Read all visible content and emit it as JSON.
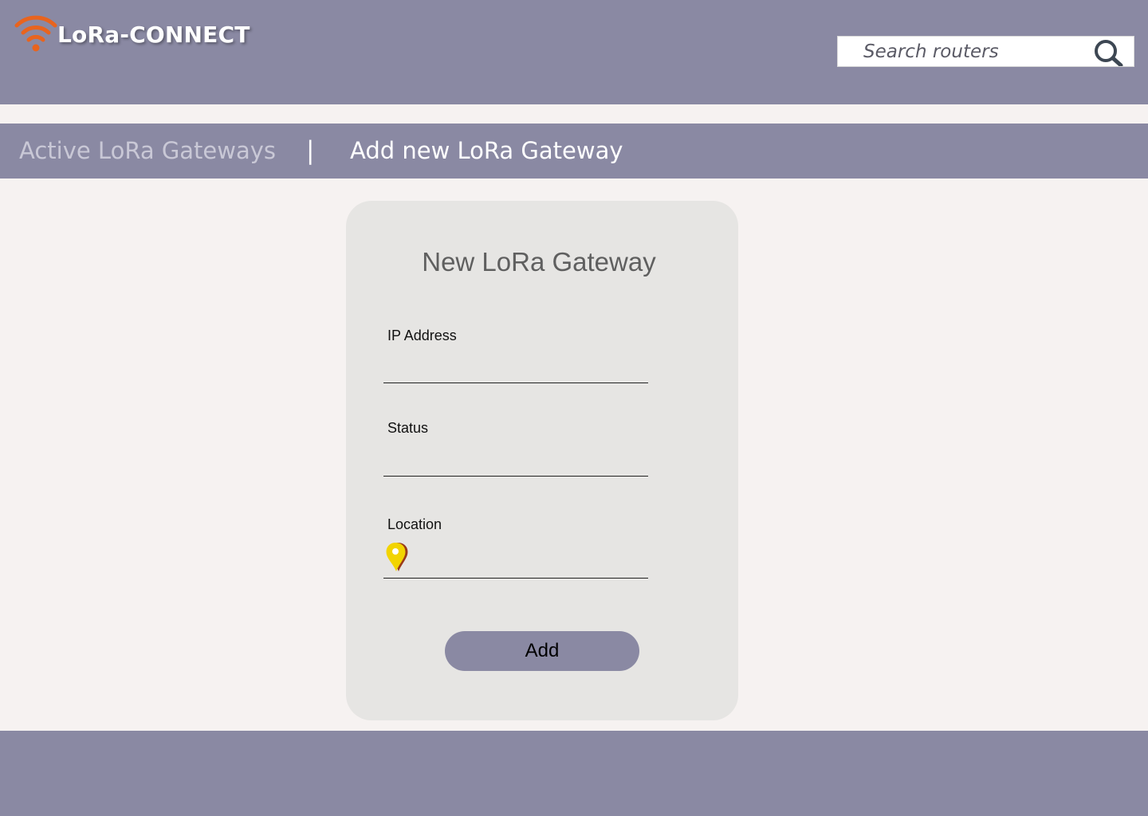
{
  "app": {
    "name": "LoRa-CONNECT",
    "logo_icon": "wifi-icon",
    "accent_color": "#e8641e",
    "brand_color": "#8a89a3"
  },
  "search": {
    "placeholder": "Search routers",
    "value": "",
    "icon": "search-icon"
  },
  "tabs": {
    "active_gateways": "Active LoRa Gateways",
    "separator": "|",
    "add_gateway": "Add new LoRa Gateway",
    "selected": "add_gateway"
  },
  "form": {
    "title": "New LoRa Gateway",
    "ip_label": "IP Address",
    "ip_value": "",
    "status_label": "Status",
    "status_value": "",
    "location_label": "Location",
    "location_value": "",
    "location_icon": "map-pin-icon",
    "submit_label": "Add"
  }
}
